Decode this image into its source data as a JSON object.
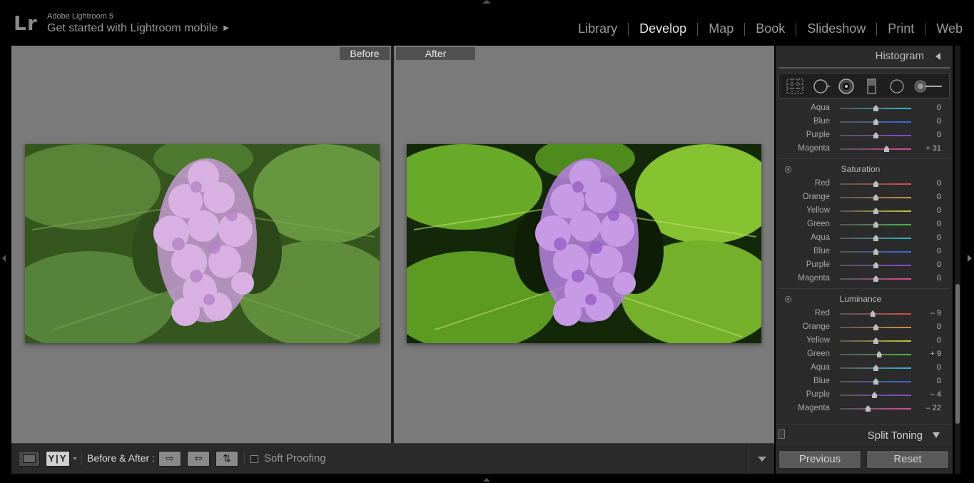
{
  "app": {
    "logo": "Lr",
    "product": "Adobe Lightroom 5",
    "mobile_link": "Get started with Lightroom mobile",
    "modules": [
      {
        "label": "Library",
        "active": false
      },
      {
        "label": "Develop",
        "active": true
      },
      {
        "label": "Map",
        "active": false
      },
      {
        "label": "Book",
        "active": false
      },
      {
        "label": "Slideshow",
        "active": false
      },
      {
        "label": "Print",
        "active": false
      },
      {
        "label": "Web",
        "active": false
      }
    ]
  },
  "view": {
    "before_label": "Before",
    "after_label": "After",
    "before_photo": {
      "leaf_color": "#4e7a30",
      "flower_color": "#c79ad6"
    },
    "after_photo": {
      "leaf_color": "#6aa52a",
      "flower_color": "#b27fd6"
    }
  },
  "toolbar": {
    "loupe_icon": "loupe-view-icon",
    "yy_label": "Y|Y",
    "before_after_label": "Before & After :",
    "swap_icons": [
      "copy-settings-right-icon",
      "copy-settings-left-icon",
      "swap-settings-icon"
    ],
    "soft_proofing_label": "Soft Proofing",
    "soft_proofing_checked": false
  },
  "panel": {
    "histogram_title": "Histogram",
    "tool_icons": [
      "crop-overlay-icon",
      "spot-removal-icon",
      "red-eye-icon",
      "graduated-filter-icon",
      "radial-filter-icon",
      "adjustment-brush-icon"
    ],
    "hue_partial": [
      {
        "label": "Aqua",
        "value": "0",
        "pos": 0.5,
        "color": "#35b6c8"
      },
      {
        "label": "Blue",
        "value": "0",
        "pos": 0.5,
        "color": "#3a6ad8"
      },
      {
        "label": "Purple",
        "value": "0",
        "pos": 0.5,
        "color": "#8a4ad8"
      },
      {
        "label": "Magenta",
        "value": "+ 31",
        "pos": 0.65,
        "color": "#d84a9a"
      }
    ],
    "saturation": {
      "title": "Saturation",
      "sliders": [
        {
          "label": "Red",
          "value": "0",
          "pos": 0.5,
          "color": "#d84a4a"
        },
        {
          "label": "Orange",
          "value": "0",
          "pos": 0.5,
          "color": "#d8904a"
        },
        {
          "label": "Yellow",
          "value": "0",
          "pos": 0.5,
          "color": "#c8c83a"
        },
        {
          "label": "Green",
          "value": "0",
          "pos": 0.5,
          "color": "#4ab84a"
        },
        {
          "label": "Aqua",
          "value": "0",
          "pos": 0.5,
          "color": "#35b6c8"
        },
        {
          "label": "Blue",
          "value": "0",
          "pos": 0.5,
          "color": "#3a6ad8"
        },
        {
          "label": "Purple",
          "value": "0",
          "pos": 0.5,
          "color": "#8a4ad8"
        },
        {
          "label": "Magenta",
          "value": "0",
          "pos": 0.5,
          "color": "#d84a9a"
        }
      ]
    },
    "luminance": {
      "title": "Luminance",
      "sliders": [
        {
          "label": "Red",
          "value": "– 9",
          "pos": 0.455,
          "color": "#d84a4a"
        },
        {
          "label": "Orange",
          "value": "0",
          "pos": 0.5,
          "color": "#d8904a"
        },
        {
          "label": "Yellow",
          "value": "0",
          "pos": 0.5,
          "color": "#c8c83a"
        },
        {
          "label": "Green",
          "value": "+ 9",
          "pos": 0.545,
          "color": "#4ab84a"
        },
        {
          "label": "Aqua",
          "value": "0",
          "pos": 0.5,
          "color": "#35b6c8"
        },
        {
          "label": "Blue",
          "value": "0",
          "pos": 0.5,
          "color": "#3a6ad8"
        },
        {
          "label": "Purple",
          "value": "– 4",
          "pos": 0.48,
          "color": "#8a4ad8"
        },
        {
          "label": "Magenta",
          "value": "– 22",
          "pos": 0.39,
          "color": "#d84a9a"
        }
      ]
    },
    "split_toning_title": "Split Toning",
    "previous_label": "Previous",
    "reset_label": "Reset"
  }
}
